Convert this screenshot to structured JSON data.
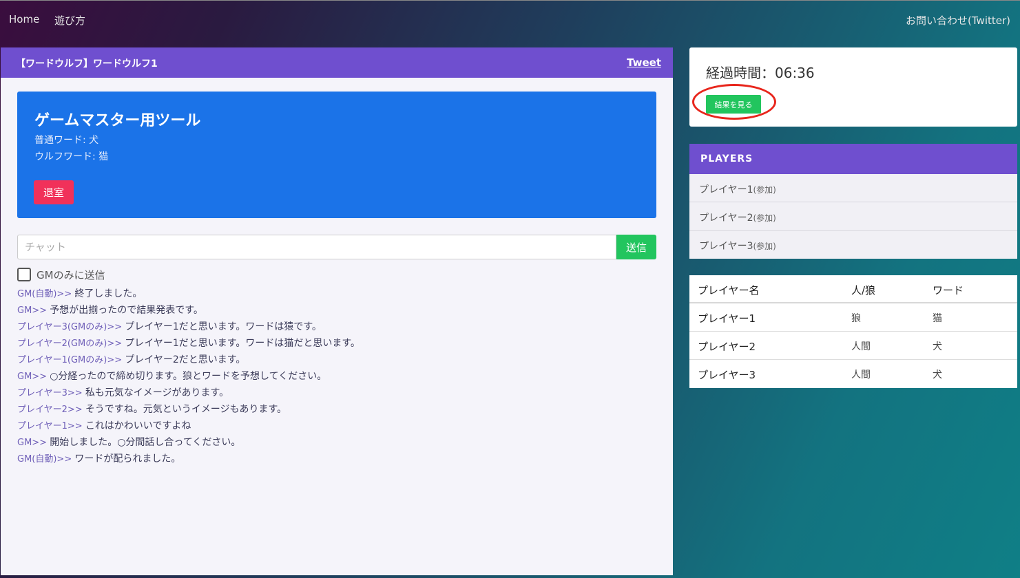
{
  "nav": {
    "home": "Home",
    "howto": "遊び方",
    "contact": "お問い合わせ(Twitter)"
  },
  "room": {
    "title": "【ワードウルフ】ワードウルフ1",
    "tweet": "Tweet"
  },
  "gm_tool": {
    "title": "ゲームマスター用ツール",
    "normal_word": "普通ワード: 犬",
    "wolf_word": "ウルフワード: 猫",
    "leave_label": "退室"
  },
  "chat": {
    "placeholder": "チャット",
    "send_label": "送信",
    "gm_only_label": "GMのみに送信"
  },
  "messages": [
    {
      "sender": "GM(自動)>> ",
      "text": "終了しました。"
    },
    {
      "sender": "GM>> ",
      "text": "予想が出揃ったので結果発表です。"
    },
    {
      "sender": "プレイヤー3(GMのみ)>> ",
      "text": "プレイヤー1だと思います。ワードは猿です。"
    },
    {
      "sender": "プレイヤー2(GMのみ)>> ",
      "text": "プレイヤー1だと思います。ワードは猫だと思います。"
    },
    {
      "sender": "プレイヤー1(GMのみ)>> ",
      "text": "プレイヤー2だと思います。"
    },
    {
      "sender": "GM>> ",
      "text": "○分経ったので締め切ります。狼とワードを予想してください。"
    },
    {
      "sender": "プレイヤー3>> ",
      "text": "私も元気なイメージがあります。"
    },
    {
      "sender": "プレイヤー2>> ",
      "text": "そうですね。元気というイメージもあります。"
    },
    {
      "sender": "プレイヤー1>> ",
      "text": "これはかわいいですよね"
    },
    {
      "sender": "GM>> ",
      "text": "開始しました。○分間話し合ってください。"
    },
    {
      "sender": "GM(自動)>> ",
      "text": "ワードが配られました。"
    }
  ],
  "timer": {
    "elapsed": "経過時間：06:36",
    "result_label": "結果を見る"
  },
  "players": {
    "title": "PLAYERS",
    "items": [
      {
        "name": "プレイヤー1",
        "status": "(参加)"
      },
      {
        "name": "プレイヤー2",
        "status": "(参加)"
      },
      {
        "name": "プレイヤー3",
        "status": "(参加)"
      }
    ]
  },
  "results": {
    "headers": [
      "プレイヤー名",
      "人/狼",
      "ワード"
    ],
    "rows": [
      [
        "プレイヤー1",
        "狼",
        "猫"
      ],
      [
        "プレイヤー2",
        "人間",
        "犬"
      ],
      [
        "プレイヤー3",
        "人間",
        "犬"
      ]
    ]
  }
}
